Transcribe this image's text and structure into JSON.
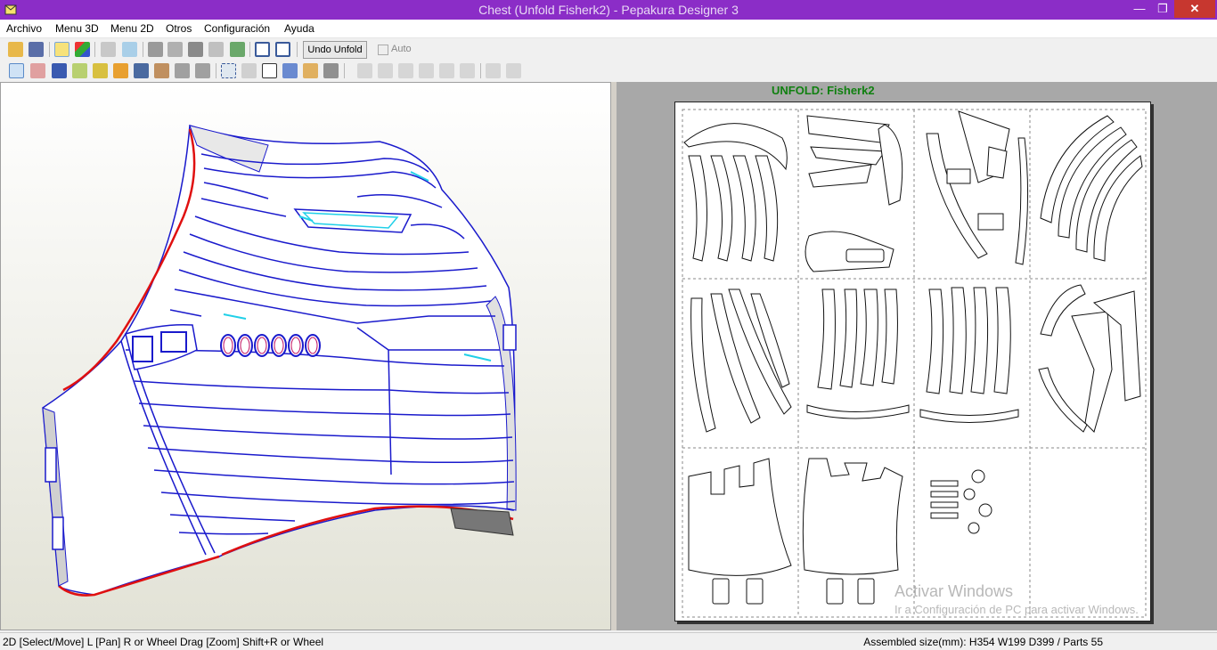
{
  "window": {
    "title": "Chest (Unfold Fisherk2) - Pepakura Designer 3",
    "min_glyph": "—",
    "max_glyph": "❐",
    "close_glyph": "✕"
  },
  "menu": [
    "Archivo",
    "Menu 3D",
    "Menu 2D",
    "Otros",
    "Configuración",
    "Ayuda"
  ],
  "toolbar": {
    "undo_unfold_label": "Undo Unfold",
    "auto_label": "Auto",
    "auto_checked": false
  },
  "unfold": {
    "title": "UNFOLD: Fisherk2"
  },
  "watermark": {
    "line1": "Activar Windows",
    "line2": "Ir a Configuración de PC para activar Windows."
  },
  "status": {
    "hint": "2D [Select/Move] L [Pan] R or Wheel Drag [Zoom] Shift+R or Wheel",
    "assembled": "Assembled size(mm): H354 W199 D399 / Parts 55"
  },
  "colors": {
    "titlebar": "#8b2dc7",
    "edge_blue": "#1a1acc",
    "edge_red": "#e01010",
    "edge_cyan": "#20d0e8",
    "unfold_title": "#108010"
  }
}
